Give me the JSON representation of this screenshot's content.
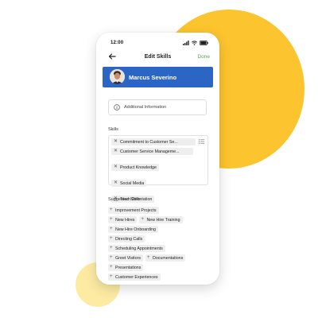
{
  "status_bar": {
    "time": "12:00"
  },
  "nav": {
    "title": "Edit Skills",
    "done_label": "Done"
  },
  "profile": {
    "name": "Marcus Severino"
  },
  "additional_info": {
    "label": "Additional Information"
  },
  "skills": {
    "label": "Skills",
    "items": [
      "Commitment to Customer Se...",
      "Customer Service Manageme...",
      "Product Knowledge",
      "Social Media",
      "Team Orientation"
    ]
  },
  "suggested": {
    "label": "Suggested Skills",
    "items": [
      "Improvement Projects",
      "New Hires",
      "New Hire Training",
      "New Hire Onboarding",
      "Directing Calls",
      "Scheduling Appointments",
      "Greet Visitors",
      "Documentations",
      "Presentations",
      "Customer Experiences"
    ]
  },
  "icons": {
    "back": "arrow-left-icon",
    "info": "info-circle-icon",
    "list": "list-icon",
    "remove": "close-icon",
    "add": "plus-icon"
  },
  "colors": {
    "accent_yellow": "#FCC42E",
    "light_yellow": "#FDEBA4",
    "profile_blue": "#2C66C4",
    "done_green": "#4CAF50",
    "chip_gray": "#EEEEEE"
  }
}
